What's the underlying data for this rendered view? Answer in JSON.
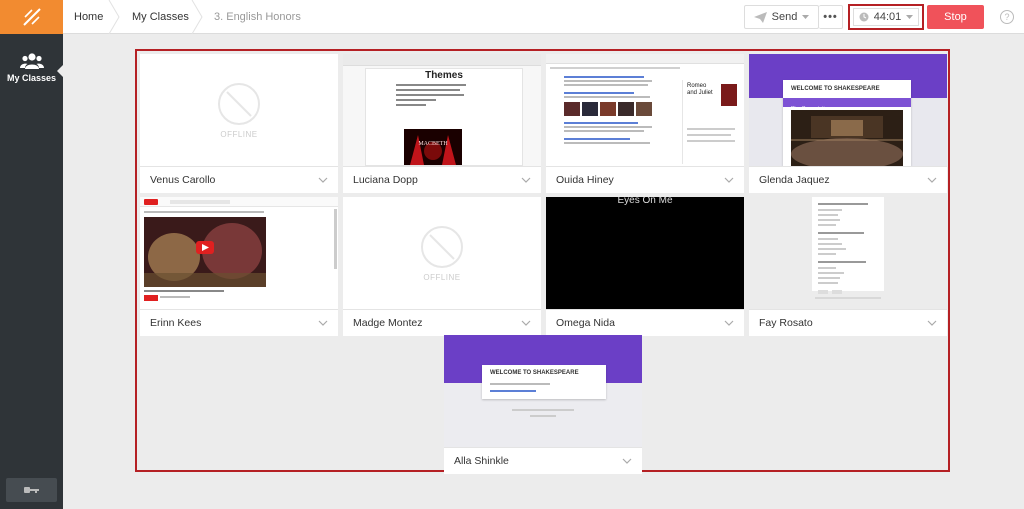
{
  "nav": {
    "my_classes": "My Classes"
  },
  "breadcrumb": {
    "home": "Home",
    "my_classes": "My Classes",
    "current": "3. English Honors"
  },
  "toolbar": {
    "send_label": "Send",
    "more_label": "•••",
    "timer": "44:01",
    "stop_label": "Stop",
    "help": "?"
  },
  "students": [
    {
      "name": "Venus Carollo",
      "status": "OFFLINE"
    },
    {
      "name": "Luciana Dopp",
      "doc_title": "Themes",
      "doc_image_label": "MACBETH"
    },
    {
      "name": "Ouida Hiney",
      "panel_title": "Romeo and Juliet"
    },
    {
      "name": "Glenda Jaquez",
      "page_title": "WELCOME TO SHAKESPEARE",
      "section_label": "Play Presentations"
    },
    {
      "name": "Erinn Kees"
    },
    {
      "name": "Madge Montez",
      "status": "OFFLINE"
    },
    {
      "name": "Omega Nida",
      "video_title": "Eyes On Me"
    },
    {
      "name": "Fay Rosato"
    },
    {
      "name": "Alla Shinkle",
      "page_title": "WELCOME TO SHAKESPEARE"
    }
  ],
  "colors": {
    "accent": "#f28b30",
    "sidebar": "#2f3438",
    "stop": "#f0525a",
    "highlight": "#b52024",
    "purple": "#6b3fc6"
  }
}
